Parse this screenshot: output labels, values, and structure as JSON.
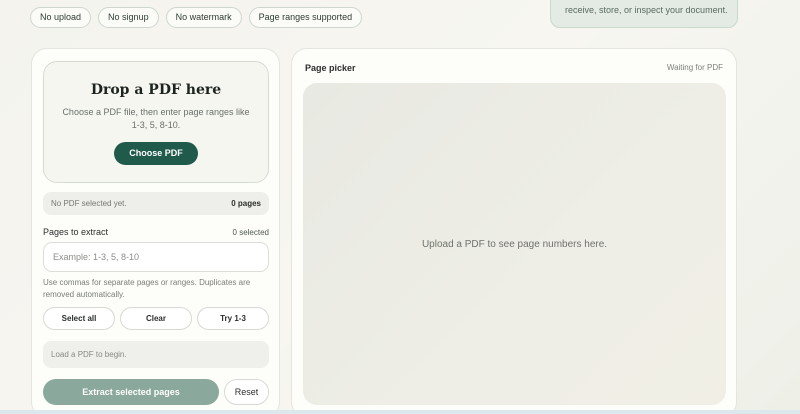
{
  "chips": [
    "No upload",
    "No signup",
    "No watermark",
    "Page ranges supported"
  ],
  "privacy_note": "receive, store, or inspect your document.",
  "dropzone": {
    "title": "Drop a PDF here",
    "subtitle": "Choose a PDF file, then enter page ranges like 1-3, 5, 8-10.",
    "button": "Choose PDF"
  },
  "file_status": {
    "text": "No PDF selected yet.",
    "count": "0 pages"
  },
  "pages": {
    "label": "Pages to extract",
    "selected": "0 selected",
    "placeholder": "Example: 1-3, 5, 8-10",
    "help": "Use commas for separate pages or ranges. Duplicates are removed automatically."
  },
  "actions": {
    "select_all": "Select all",
    "clear": "Clear",
    "try": "Try 1-3"
  },
  "message": "Load a PDF to begin.",
  "extract_button": "Extract selected pages",
  "reset_button": "Reset",
  "picker": {
    "title": "Page picker",
    "status": "Waiting for PDF",
    "empty": "Upload a PDF to see page numbers here."
  },
  "colors": {
    "accent": "#1f5a4a",
    "accent_disabled": "#8aa89c"
  }
}
